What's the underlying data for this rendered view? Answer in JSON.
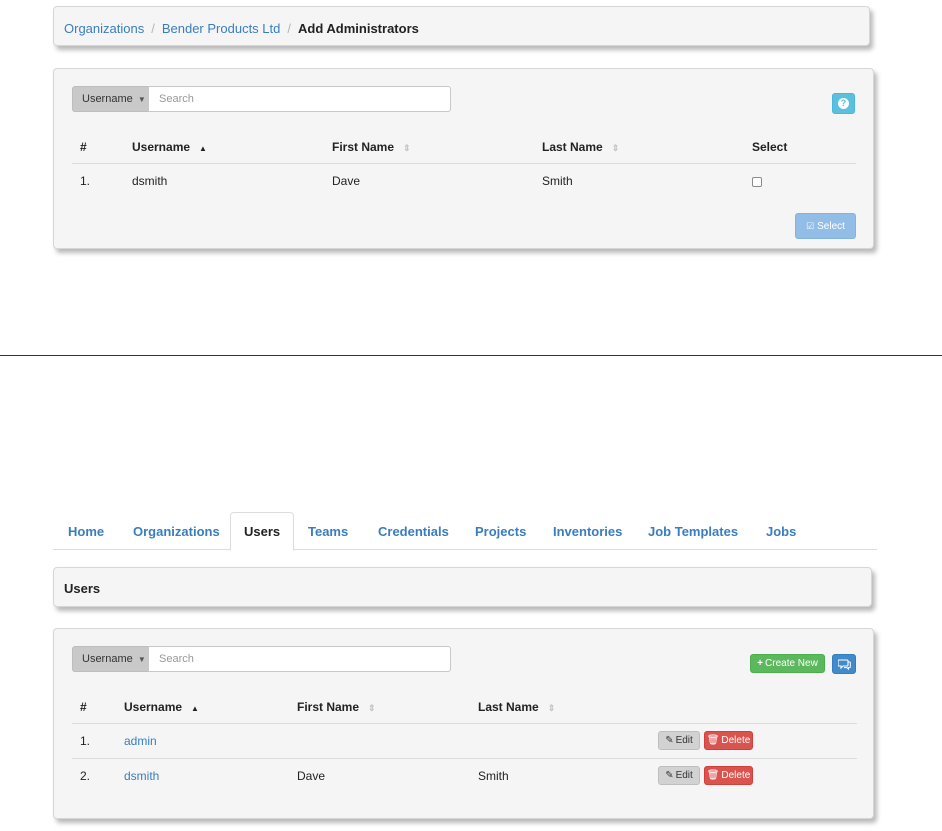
{
  "admin_panel": {
    "breadcrumb": [
      {
        "label": "Organizations"
      },
      {
        "label": "Bender Products Ltd"
      },
      {
        "label": "Add Administrators"
      }
    ],
    "search": {
      "field_label": "Username",
      "placeholder": "Search"
    },
    "columns": [
      "#",
      "Username",
      "First Name",
      "Last Name",
      "Select"
    ],
    "rows": [
      {
        "num": "1.",
        "username": "dsmith",
        "first_name": "Dave",
        "last_name": "Smith",
        "selected": false
      }
    ],
    "select_button": "Select",
    "colors": {
      "help": "#5bc0de",
      "select": "#92bde6"
    }
  },
  "users_page": {
    "tabs": [
      {
        "label": "Home"
      },
      {
        "label": "Organizations"
      },
      {
        "label": "Users",
        "active": true
      },
      {
        "label": "Teams"
      },
      {
        "label": "Credentials"
      },
      {
        "label": "Projects"
      },
      {
        "label": "Inventories"
      },
      {
        "label": "Job Templates"
      },
      {
        "label": "Jobs"
      }
    ],
    "title": "Users",
    "search": {
      "field_label": "Username",
      "placeholder": "Search"
    },
    "create_button": "Create New",
    "columns": [
      "#",
      "Username",
      "First Name",
      "Last Name"
    ],
    "rows": [
      {
        "num": "1.",
        "username": "admin",
        "first_name": "",
        "last_name": ""
      },
      {
        "num": "2.",
        "username": "dsmith",
        "first_name": "Dave",
        "last_name": "Smith"
      }
    ],
    "edit_label": "Edit",
    "delete_label": "Delete",
    "colors": {
      "create": "#5cb85c",
      "delete": "#d9534f",
      "chat": "#428bca",
      "link": "#3a7dbf"
    }
  }
}
